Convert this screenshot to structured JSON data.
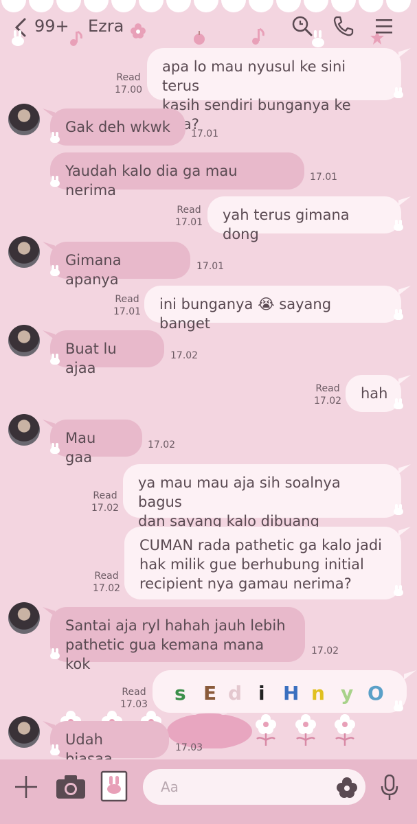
{
  "header": {
    "unread_count": "99+",
    "contact_name": "Ezra"
  },
  "icons": {
    "back": "chevron-left-icon",
    "search": "search-clock-icon",
    "call": "phone-icon",
    "menu": "hamburger-menu-icon"
  },
  "messages": [
    {
      "dir": "out",
      "text": "apa lo mau nyusul ke sini terus\nkasih sendiri bunganya ke livia?",
      "read": "Read",
      "time": "17.00"
    },
    {
      "dir": "in",
      "text": "Gak deh wkwk",
      "time": "17.01"
    },
    {
      "dir": "in",
      "text": "Yaudah kalo dia ga mau nerima",
      "time": "17.01"
    },
    {
      "dir": "out",
      "text": "yah terus gimana dong",
      "read": "Read",
      "time": "17.01"
    },
    {
      "dir": "in",
      "text": "Gimana apanya",
      "time": "17.01"
    },
    {
      "dir": "out",
      "text": "ini bunganya 😭 sayang banget",
      "read": "Read",
      "time": "17.01"
    },
    {
      "dir": "in",
      "text": "Buat lu ajaa",
      "time": "17.02"
    },
    {
      "dir": "out",
      "text": "hah",
      "read": "Read",
      "time": "17.02"
    },
    {
      "dir": "in",
      "text": "Mau gaa",
      "time": "17.02"
    },
    {
      "dir": "out",
      "text": "ya mau mau aja sih soalnya bagus\ndan sayang kalo dibuang",
      "read": "Read",
      "time": "17.02"
    },
    {
      "dir": "out",
      "text": "CUMAN rada pathetic ga kalo jadi\nhak milik gue berhubung initial\nrecipient nya gamau nerima?",
      "read": "Read",
      "time": "17.02"
    },
    {
      "dir": "in",
      "text": "Santai aja ryl hahah jauh lebih\npathetic gua kemana mana kok",
      "time": "17.02"
    },
    {
      "dir": "out",
      "sticker": [
        "s",
        "E",
        "d",
        "i",
        "H",
        "n",
        "y",
        "O"
      ],
      "read": "Read",
      "time": "17.03"
    },
    {
      "dir": "in",
      "text": "Udah biasaa",
      "time": "17.03"
    }
  ],
  "sticker_colors": [
    "#3b8f4a",
    "#8a5a3a",
    "#e4c8cf",
    "#222222",
    "#3a6fbf",
    "#e0c021",
    "#a8d28a",
    "#5aa0c8"
  ],
  "input": {
    "placeholder": "Aa"
  },
  "colors": {
    "background": "#f3d5e0",
    "incoming": "#e8b9cb",
    "outgoing": "#fdf1f5",
    "toolbar": "#e8b9cb"
  }
}
